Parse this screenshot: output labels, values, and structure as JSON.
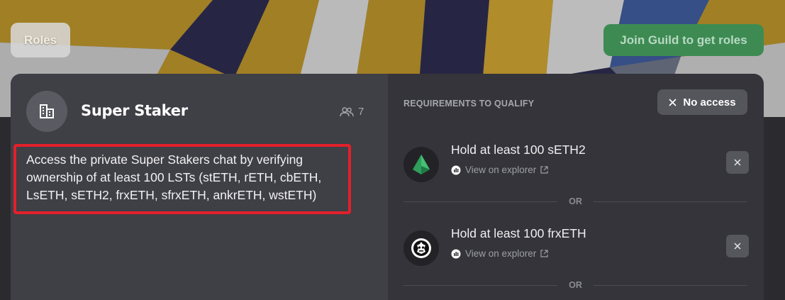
{
  "header": {
    "roles_label": "Roles",
    "join_label": "Join Guild to get roles"
  },
  "role": {
    "name": "Super Staker",
    "member_count": "7",
    "description": "Access the private Super Stakers chat by verifying ownership of at least 100 LSTs (stETH, rETH, cbETH, LsETH, sETH2, frxETH, sfrxETH, ankrETH, wstETH)"
  },
  "requirements": {
    "heading": "REQUIREMENTS TO QUALIFY",
    "access_status": "No access",
    "separator": "OR",
    "items": [
      {
        "title": "Hold at least 100 sETH2",
        "link": "View on explorer",
        "icon": "seth2-token-icon"
      },
      {
        "title": "Hold at least 100 frxETH",
        "link": "View on explorer",
        "icon": "frxeth-token-icon"
      }
    ]
  },
  "colors": {
    "highlight": "#e3202a",
    "join_button": "#3d8b53",
    "card_left": "#3f3f46",
    "card_right": "#34343a"
  }
}
